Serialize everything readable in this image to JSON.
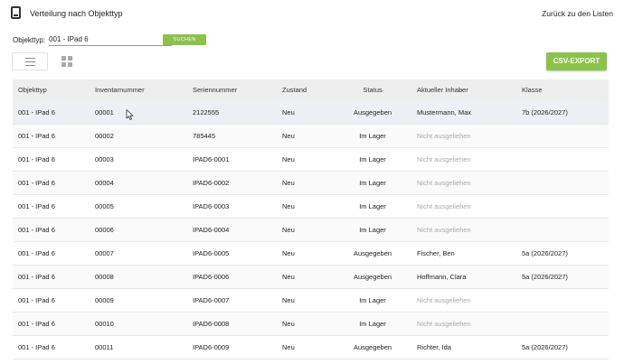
{
  "header": {
    "icon": "tablet-icon",
    "title": "Verteilung nach Objekttyp",
    "back_link": "Zurück zu den Listen"
  },
  "filter": {
    "label": "Objekttyp:",
    "selected": "001 - IPad 6",
    "search_label": "SUCHEN"
  },
  "toolbar": {
    "list_view_icon": "list-icon",
    "grid_view_icon": "grid-icon",
    "export_label": "CSV-EXPORT",
    "accent_color": "#8bc34a"
  },
  "table": {
    "columns": [
      "Objekttyp",
      "Inventarnummer",
      "Seriennummer",
      "Zustand",
      "Status",
      "Aktueller Inhaber",
      "Klasse"
    ],
    "rows": [
      [
        "001 - IPad 6",
        "00001",
        "2122555",
        "Neu",
        "Ausgegeben",
        "Mustermann, Max",
        "7b (2026/2027)"
      ],
      [
        "001 - IPad 6",
        "00002",
        "785445",
        "Neu",
        "Im Lager",
        "Nicht ausgeliehen",
        ""
      ],
      [
        "001 - IPad 6",
        "00003",
        "IPAD6-0001",
        "Neu",
        "Im Lager",
        "Nicht ausgeliehen",
        ""
      ],
      [
        "001 - IPad 6",
        "00004",
        "IPAD6-0002",
        "Neu",
        "Im Lager",
        "Nicht ausgeliehen",
        ""
      ],
      [
        "001 - IPad 6",
        "00005",
        "IPAD6-0003",
        "Neu",
        "Im Lager",
        "Nicht ausgeliehen",
        ""
      ],
      [
        "001 - IPad 6",
        "00006",
        "IPAD6-0004",
        "Neu",
        "Im Lager",
        "Nicht ausgeliehen",
        ""
      ],
      [
        "001 - IPad 6",
        "00007",
        "IPAD6-0005",
        "Neu",
        "Ausgegeben",
        "Fischer, Ben",
        "5a (2026/2027)"
      ],
      [
        "001 - IPad 6",
        "00008",
        "IPAD6-0006",
        "Neu",
        "Ausgegeben",
        "Hoffmann, Clara",
        "5a (2026/2027)"
      ],
      [
        "001 - IPad 6",
        "00009",
        "IPAD6-0007",
        "Neu",
        "Im Lager",
        "Nicht ausgeliehen",
        ""
      ],
      [
        "001 - IPad 6",
        "00010",
        "IPAD6-0008",
        "Neu",
        "Im Lager",
        "Nicht ausgeliehen",
        ""
      ],
      [
        "001 - IPad 6",
        "00011",
        "IPAD6-0009",
        "Neu",
        "Ausgegeben",
        "Richter, Ida",
        "5a (2026/2027)"
      ]
    ],
    "placeholder_owner": "Nicht ausgeliehen"
  }
}
